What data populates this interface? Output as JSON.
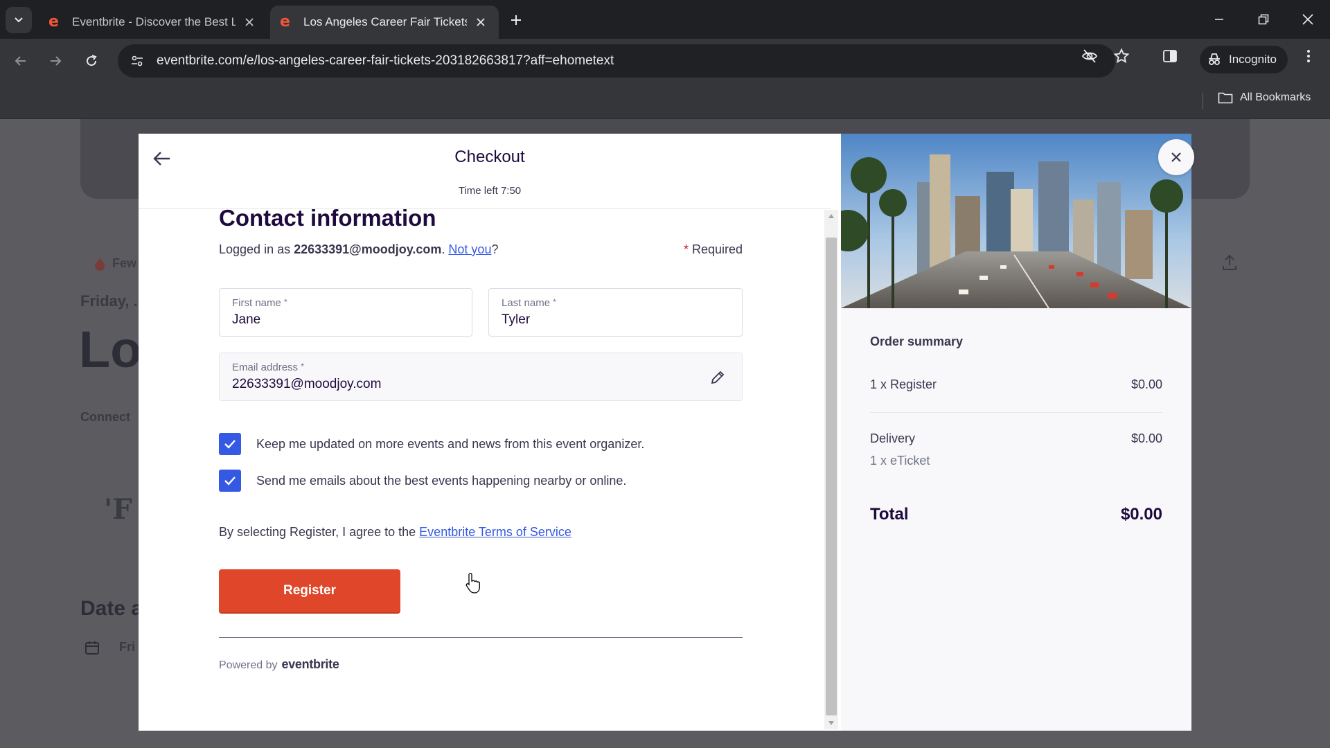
{
  "browser": {
    "tabs": [
      {
        "title": "Eventbrite - Discover the Best L",
        "active": false
      },
      {
        "title": "Los Angeles Career Fair Tickets,",
        "active": true
      }
    ],
    "url": "eventbrite.com/e/los-angeles-career-fair-tickets-203182663817?aff=ehometext",
    "incognito_label": "Incognito",
    "bookmarks_label": "All Bookmarks"
  },
  "background": {
    "few": "Few",
    "friday": "Friday, .",
    "title_fragment": "Los",
    "connect": "Connect",
    "logo_text": "'F",
    "date_heading": "Date a",
    "date_fragment": "Fri"
  },
  "checkout": {
    "title": "Checkout",
    "timer": "Time left 7:50",
    "heading": "Contact information",
    "logged_in_prefix": "Logged in as ",
    "logged_in_email": "22633391@moodjoy.com",
    "logged_in_sep": ". ",
    "not_you": "Not you",
    "not_you_suffix": "?",
    "required_star": "*",
    "required_label": " Required",
    "first_name": {
      "label": "First name",
      "value": "Jane"
    },
    "last_name": {
      "label": "Last name",
      "value": "Tyler"
    },
    "email": {
      "label": "Email address",
      "value": "22633391@moodjoy.com"
    },
    "field_star": "*",
    "checkbox_1": {
      "label": "Keep me updated on more events and news from this event organizer.",
      "checked": true
    },
    "checkbox_2": {
      "label": "Send me emails about the best events happening nearby or online.",
      "checked": true
    },
    "terms_prefix": "By selecting Register, I agree to the ",
    "terms_link": "Eventbrite Terms of Service",
    "register_label": "Register",
    "powered_by": "Powered by",
    "brand": "eventbrite"
  },
  "order_summary": {
    "title": "Order summary",
    "line_item": {
      "label": "1 x Register",
      "price": "$0.00"
    },
    "delivery": {
      "label": "Delivery",
      "price": "$0.00",
      "detail": "1 x eTicket"
    },
    "total": {
      "label": "Total",
      "price": "$0.00"
    }
  },
  "colors": {
    "accent_blue": "#3659e3",
    "register_orange": "#e0472a",
    "brand_orange": "#f05537",
    "text_dark": "#1e0a3c"
  },
  "icons": [
    "tab-search-icon",
    "eventbrite-favicon",
    "close-icon",
    "plus-icon",
    "minimize-icon",
    "restore-icon",
    "back-arrow-icon",
    "forward-arrow-icon",
    "reload-icon",
    "site-settings-icon",
    "eye-off-icon",
    "star-icon",
    "side-panel-icon",
    "incognito-icon",
    "kebab-menu-icon",
    "folder-icon",
    "pencil-icon",
    "check-icon",
    "upload-icon",
    "calendar-icon",
    "pointer-cursor-icon"
  ]
}
